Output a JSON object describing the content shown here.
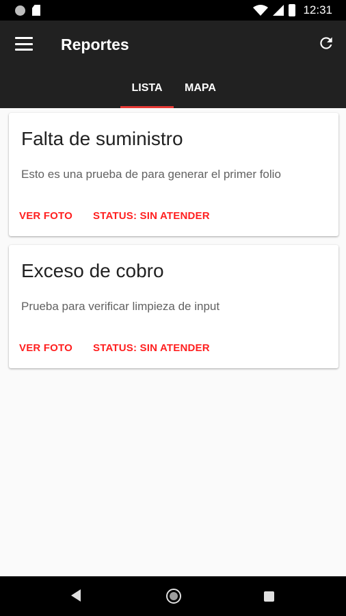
{
  "status_bar": {
    "time": "12:31",
    "icons": [
      "notification-dot-icon",
      "sd-card-icon",
      "wifi-icon",
      "signal-icon",
      "battery-icon"
    ]
  },
  "app_bar": {
    "title": "Reportes",
    "menu_icon": "menu-icon",
    "refresh_icon": "refresh-icon"
  },
  "tabs": [
    {
      "label": "LISTA",
      "selected": true
    },
    {
      "label": "MAPA",
      "selected": false
    }
  ],
  "reports": [
    {
      "title": "Falta de suministro",
      "description": "Esto es una prueba de para generar el primer folio",
      "photo_label": "VER FOTO",
      "status_label": "STATUS: SIN ATENDER"
    },
    {
      "title": "Exceso de cobro",
      "description": "Prueba para verificar limpieza de input",
      "photo_label": "VER FOTO",
      "status_label": "STATUS: SIN ATENDER"
    }
  ],
  "colors": {
    "app_bar": "#212121",
    "accent": "#e53935",
    "action_text": "#ff1f1f",
    "background": "#fafafa"
  },
  "nav_bar": {
    "icons": [
      "back-icon",
      "home-icon",
      "recents-icon"
    ]
  }
}
